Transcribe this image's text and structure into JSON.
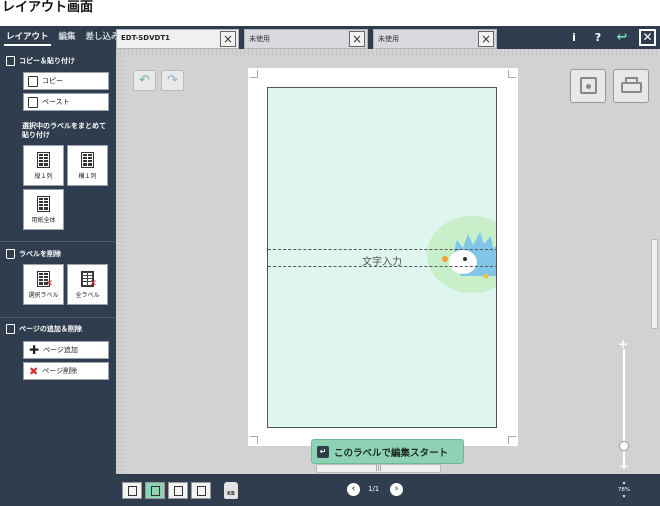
{
  "page_caption": "レイアウト画面",
  "main_tabs": [
    "レイアウト",
    "編集",
    "差し込み"
  ],
  "doc_tabs": [
    {
      "label": "EDT-SDVDT1"
    },
    {
      "label": "未使用"
    },
    {
      "label": "未使用"
    }
  ],
  "top_icons": {
    "info": "i",
    "help": "?",
    "undo": "↩",
    "close": "✕"
  },
  "sidebar": {
    "copy_section": "コピー＆貼り付け",
    "copy_button": "コピー",
    "paste_button": "ペースト",
    "bulk_paste_heading": "選択中のラベルをまとめて貼り付け",
    "vertical_button": "縦１列",
    "horizontal_button": "横１列",
    "whole_sheet_button": "用紙全体",
    "delete_section": "ラベルを削除",
    "delete_selected_button": "選択ラベル",
    "delete_all_button": "全ラベル",
    "page_section": "ページの追加＆削除",
    "add_page_button": "ページ追加",
    "delete_page_button": "ページ削除"
  },
  "canvas": {
    "text_placeholder": "文字入力",
    "start_button": "このラベルで編集スタート",
    "scroll_handle": "|||"
  },
  "bottom": {
    "page_indicator": "1/1",
    "zoom_level": "78%",
    "kb_label": "KB"
  },
  "colors": {
    "dark_panel": "#2f3d4e",
    "label_fill": "#def6ee",
    "accent_green": "#8ed1b4",
    "hedgehog_blue": "#7fc6e8"
  }
}
